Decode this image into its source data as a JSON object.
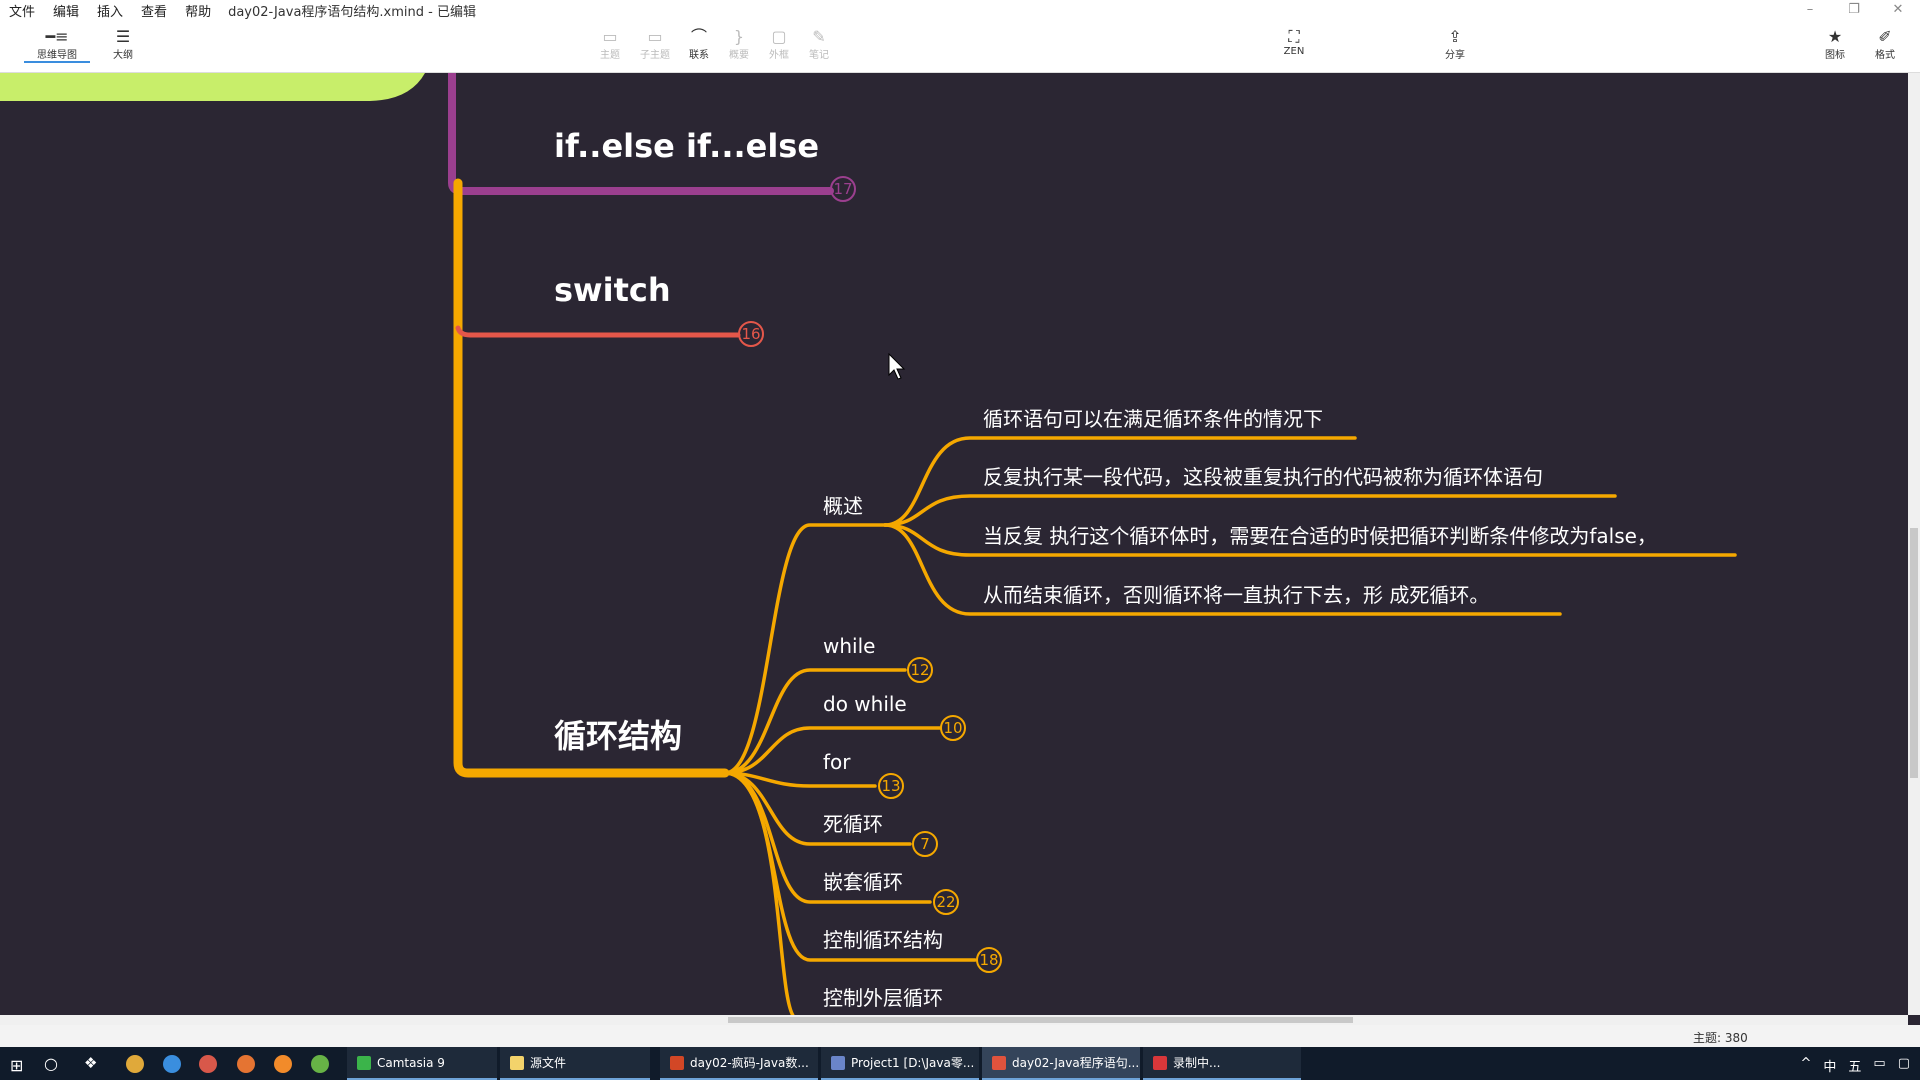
{
  "menu": {
    "items": [
      "文件",
      "编辑",
      "插入",
      "查看",
      "帮助"
    ],
    "title": "day02-Java程序语句结构.xmind - 已编辑"
  },
  "window": {
    "minimize": "–",
    "restore": "❐",
    "close": "✕"
  },
  "toolbar": {
    "left": [
      {
        "label": "思维导图",
        "icon": "mindmap-icon"
      },
      {
        "label": "大纲",
        "icon": "outline-icon"
      }
    ],
    "center": [
      {
        "label": "主题",
        "icon": "topic-icon"
      },
      {
        "label": "子主题",
        "icon": "subtopic-icon"
      },
      {
        "label": "联系",
        "icon": "relationship-icon"
      },
      {
        "label": "概要",
        "icon": "summary-icon"
      },
      {
        "label": "外框",
        "icon": "boundary-icon"
      },
      {
        "label": "笔记",
        "icon": "note-icon"
      }
    ],
    "zen": "ZEN",
    "share": "分享",
    "right": [
      {
        "label": "图标",
        "icon": "star-icon"
      },
      {
        "label": "格式",
        "icon": "brush-icon"
      }
    ]
  },
  "mindmap": {
    "branch_ifelse": {
      "label": "if..else if...else",
      "count": "17",
      "color": "#9b3f8f"
    },
    "branch_switch": {
      "label": "switch",
      "count": "16",
      "color": "#e4574a"
    },
    "branch_loop": {
      "label": "循环结构",
      "color": "#f5a800"
    },
    "overview": {
      "label": "概述"
    },
    "overview_lines": [
      "循环语句可以在满足循环条件的情况下",
      "反复执行某一段代码，这段被重复执行的代码被称为循环体语句",
      "当反复 执行这个循环体时，需要在合适的时候把循环判断条件修改为false，",
      "从而结束循环，否则循环将一直执行下去，形 成死循环。"
    ],
    "loop_children": [
      {
        "label": "while",
        "count": "12"
      },
      {
        "label": "do while",
        "count": "10"
      },
      {
        "label": "for",
        "count": "13"
      },
      {
        "label": "死循环",
        "count": "7"
      },
      {
        "label": "嵌套循环",
        "count": "22"
      },
      {
        "label": "控制循环结构",
        "count": "18"
      },
      {
        "label": "控制外层循环",
        "count": ""
      }
    ],
    "top_green_color": "#c8ee6a"
  },
  "status": {
    "topic_count": "主题: 380"
  },
  "taskbar": {
    "items": [
      "Camtasia 9",
      "源文件",
      "day02-疯码-Java数...",
      "Project1 [D:\\Java零...",
      "day02-Java程序语句...",
      "录制中..."
    ],
    "tray": [
      "^",
      "中",
      "五"
    ]
  }
}
